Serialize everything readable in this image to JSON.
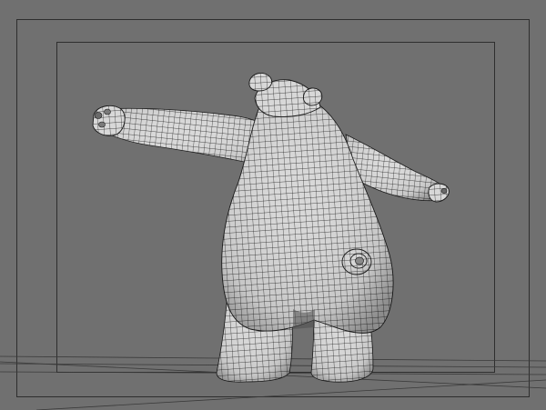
{
  "viewport": {
    "label": "",
    "background": "#707070",
    "frame_line_color": "#2e2e2e",
    "mesh_line_color": "#1a1a1a",
    "mesh_fill_color": "#d6d6d6",
    "shading_color": "#9a9a9a"
  },
  "model": {
    "name": "",
    "display_mode": "wireframe-on-shaded"
  }
}
